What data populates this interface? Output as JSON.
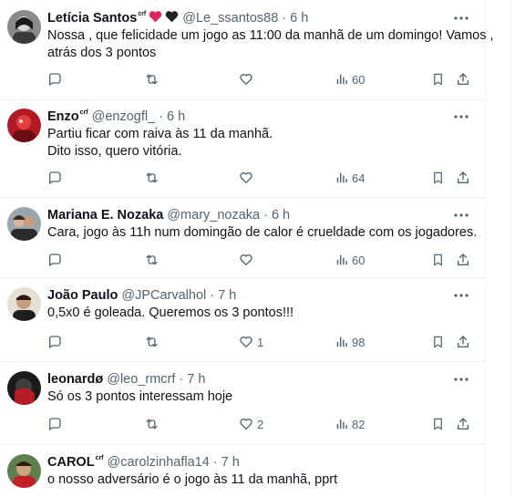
{
  "tweets": [
    {
      "name": "Letícia Santos",
      "badge": "crf",
      "emojis": [
        "red-heart",
        "black-heart"
      ],
      "handle": "@Le_ssantos88",
      "time": "6 h",
      "lines": [
        "Nossa , que felicidade um jogo as 11:00 da manhã de um domingo! Vamos ,",
        "atrás dos 3 pontos"
      ],
      "likes": "",
      "views": "60"
    },
    {
      "name": "Enzo",
      "badge": "crf",
      "emojis": [],
      "handle": "@enzogfl_",
      "time": "6 h",
      "lines": [
        "Partiu ficar com raiva às 11 da manhã.",
        "Dito isso, quero vitória."
      ],
      "likes": "",
      "views": "64"
    },
    {
      "name": "Mariana E. Nozaka",
      "badge": "",
      "emojis": [],
      "handle": "@mary_nozaka",
      "time": "6 h",
      "lines": [
        "Cara, jogo às 11h num domingão de calor é crueldade com os jogadores."
      ],
      "likes": "",
      "views": "60"
    },
    {
      "name": "João Paulo",
      "badge": "",
      "emojis": [],
      "handle": "@JPCarvalhol",
      "time": "7 h",
      "lines": [
        "0,5x0 é goleada. Queremos os 3 pontos!!!"
      ],
      "likes": "1",
      "views": "98"
    },
    {
      "name": "leonardø",
      "badge": "",
      "emojis": [],
      "handle": "@leo_rmcrf",
      "time": "7 h",
      "lines": [
        "Só os 3 pontos interessam hoje"
      ],
      "likes": "2",
      "views": "82"
    },
    {
      "name": "CAROL",
      "badge": "crf",
      "emojis": [],
      "handle": "@carolzinhafla14",
      "time": "7 h",
      "lines": [
        "o nosso adversário é o jogo às 11 da manhã, pprt"
      ],
      "likes": "",
      "views": ""
    }
  ],
  "colors": {
    "text": "#0f1419",
    "secondary": "#536471",
    "divider": "#eff3f4",
    "heart_red": "#e0245e",
    "heart_black": "#222222"
  },
  "icons": [
    "reply-icon",
    "retweet-icon",
    "like-icon",
    "views-icon",
    "bookmark-icon",
    "share-icon",
    "more-icon"
  ]
}
